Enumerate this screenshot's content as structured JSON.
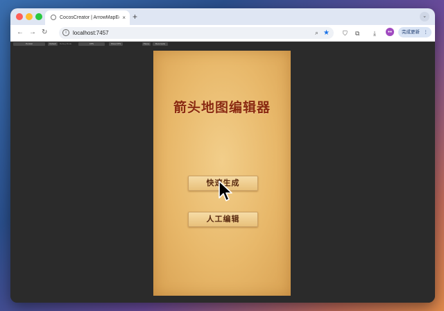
{
  "browser": {
    "tab_title": "CocosCreator | ArrowMapEdit",
    "tab_close": "×",
    "new_tab": "+",
    "tab_menu": "⌄",
    "url": "localhost:7457",
    "update_label": "完成更新",
    "update_dots": "⋮"
  },
  "cocos_toolbar": {
    "items": [
      "Portrait",
      "Default",
      "Debug Mode",
      "FPS",
      "Show FPS",
      "Pause",
      "Recompile"
    ]
  },
  "game": {
    "title": "箭头地图编辑器",
    "buttons": {
      "quick_generate": "快速生成",
      "manual_edit": "人工编辑"
    }
  },
  "colors": {
    "title_red": "#8a2a10",
    "parchment": "#e8b86a",
    "button_text": "#5a2a10"
  }
}
